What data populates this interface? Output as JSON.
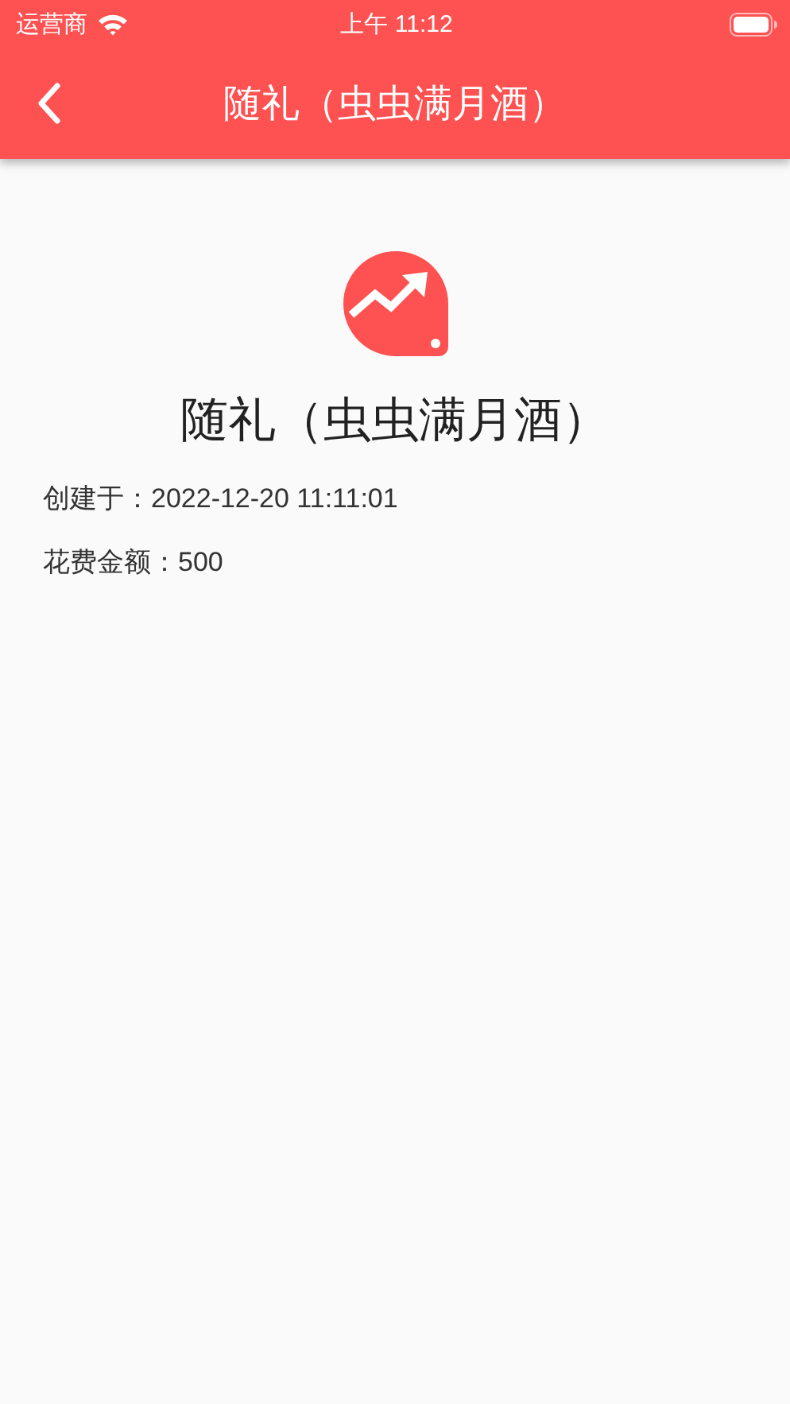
{
  "status_bar": {
    "carrier": "运营商",
    "time": "上午 11:12"
  },
  "nav_bar": {
    "title": "随礼（虫虫满月酒）"
  },
  "detail": {
    "title": "随礼（虫虫满月酒）",
    "fields": [
      {
        "text": "创建于：2022-12-20 11:11:01"
      },
      {
        "text": "花费金额：500"
      }
    ]
  }
}
